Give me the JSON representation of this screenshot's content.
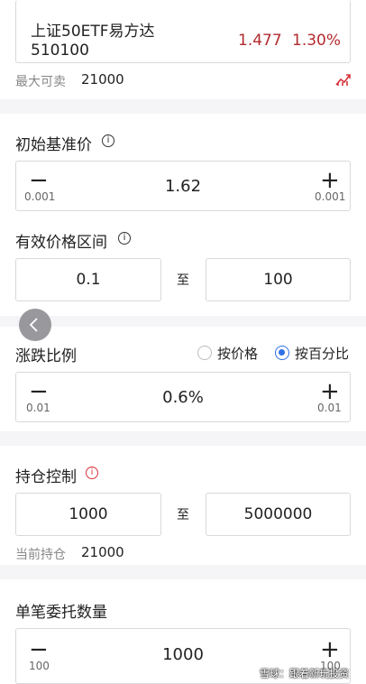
{
  "security": {
    "name": "上证50ETF易方达",
    "code": "510100",
    "price": "1.477",
    "change_pct": "1.30%",
    "max_sell_label": "最大可卖",
    "max_sell_value": "21000"
  },
  "base_price": {
    "label": "初始基准价",
    "value": "1.62",
    "minus": "−",
    "plus": "+",
    "step_minus": "0.001",
    "step_plus": "0.001"
  },
  "valid_range": {
    "label": "有效价格区间",
    "from": "0.1",
    "to_sep": "至",
    "to": "100"
  },
  "swing": {
    "label": "涨跌比例",
    "opt_price": "按价格",
    "opt_percent": "按百分比",
    "value": "0.6%",
    "minus": "−",
    "plus": "+",
    "step_minus": "0.01",
    "step_plus": "0.01"
  },
  "position": {
    "label": "持仓控制",
    "from": "1000",
    "to_sep": "至",
    "to": "5000000",
    "current_label": "当前持仓",
    "current_value": "21000"
  },
  "order_qty": {
    "label": "单笔委托数量",
    "value": "1000",
    "minus": "−",
    "plus": "+",
    "step_minus": "100",
    "step_plus": "100"
  },
  "watermark": "雪球：跟着新玩投资",
  "colors": {
    "accent": "#2f6fe5",
    "price": "#b22a2e",
    "warn": "#d6333a"
  }
}
